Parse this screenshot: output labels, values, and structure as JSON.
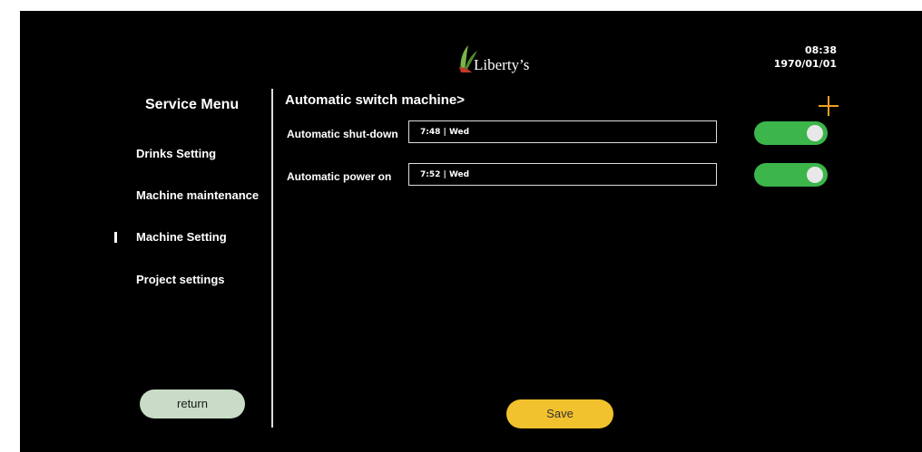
{
  "header": {
    "logo_text": "Liberty’s",
    "time": "08:38",
    "date": "1970/01/01"
  },
  "sidebar": {
    "title": "Service Menu",
    "items": [
      {
        "label": "Drinks Setting"
      },
      {
        "label": "Machine maintenance"
      },
      {
        "label": "Machine Setting",
        "active": true
      },
      {
        "label": "Project settings"
      }
    ],
    "return_label": "return"
  },
  "main": {
    "section_title": "Automatic switch machine>",
    "rows": [
      {
        "label": "Automatic shut-down",
        "value": "7:48 | Wed",
        "enabled": true
      },
      {
        "label": "Automatic power on",
        "value": "7:52 | Wed",
        "enabled": true
      }
    ],
    "save_label": "Save"
  },
  "colors": {
    "toggle_on": "#3cb54a",
    "add_icon": "#f0a020",
    "save_button": "#f2c12e",
    "return_button": "#c8dcc6"
  },
  "icons": {
    "logo": "leaf-logo-icon",
    "add": "plus-icon"
  }
}
